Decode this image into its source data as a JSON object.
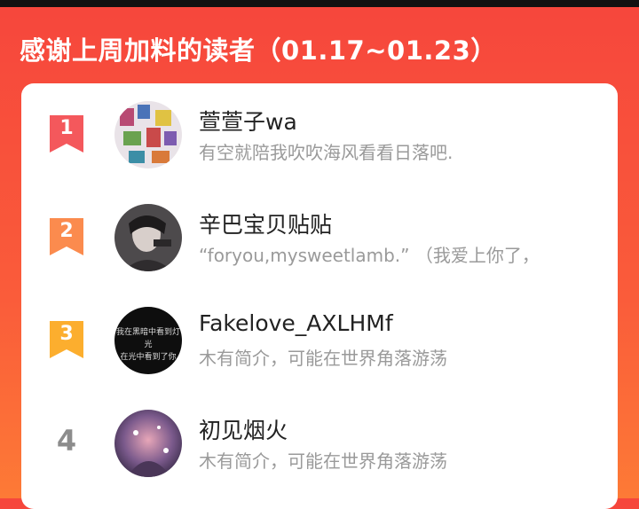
{
  "header": {
    "title": "感谢上周加料的读者（01.17~01.23）"
  },
  "colors": {
    "rank1": "#f4585c",
    "rank2": "#fb8b4e",
    "rank3": "#fcae2e",
    "rank_plain": "#8c8c8c"
  },
  "readers": [
    {
      "rank": "1",
      "name": "萱萱子wa",
      "bio": "有空就陪我吹吹海风看看日落吧."
    },
    {
      "rank": "2",
      "name": "辛巴宝贝贴贴",
      "bio": "“foryou,mysweetlamb.” （我爱上你了，"
    },
    {
      "rank": "3",
      "name": "Fakelove_AXLHMf",
      "bio": "木有简介，可能在世界角落游荡",
      "avatar_text": [
        "我在黑暗中看到灯光",
        "在光中看到了你"
      ]
    },
    {
      "rank": "4",
      "name": "初见烟火",
      "bio": "木有简介，可能在世界角落游荡"
    }
  ]
}
